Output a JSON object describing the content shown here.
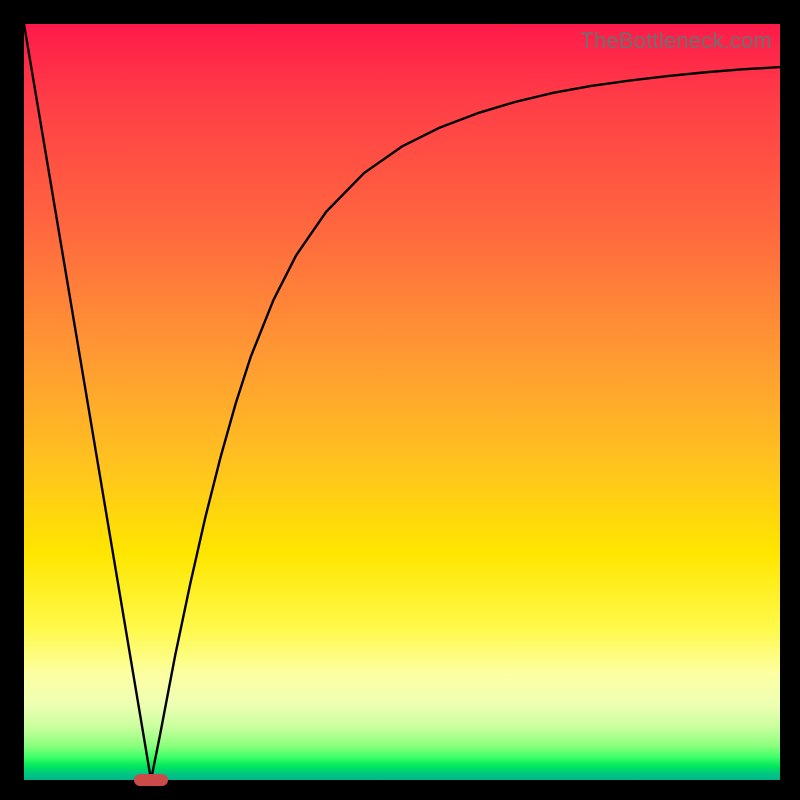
{
  "watermark": "TheBottleneck.com",
  "colors": {
    "frame": "#000000",
    "curve": "#000000",
    "min_marker": "#cc4b49",
    "gradient_top": "#ff1a4a",
    "gradient_bottom": "#00b58e"
  },
  "chart_data": {
    "type": "line",
    "title": "",
    "xlabel": "",
    "ylabel": "",
    "xlim": [
      0,
      100
    ],
    "ylim": [
      0,
      100
    ],
    "grid": false,
    "legend": false,
    "series": [
      {
        "name": "bottleneck-curve",
        "x": [
          0,
          2,
          4,
          6,
          8,
          10,
          12,
          14,
          16,
          16.8,
          18,
          20,
          22,
          24,
          26,
          28,
          30,
          33,
          36,
          40,
          45,
          50,
          55,
          60,
          65,
          70,
          75,
          80,
          85,
          90,
          95,
          100
        ],
        "y": [
          100,
          88.1,
          76.2,
          64.3,
          52.4,
          40.5,
          28.6,
          16.7,
          4.8,
          0,
          6.0,
          16.5,
          26.0,
          34.8,
          42.7,
          49.8,
          56.0,
          63.5,
          69.4,
          75.2,
          80.3,
          83.8,
          86.3,
          88.2,
          89.7,
          90.9,
          91.8,
          92.5,
          93.1,
          93.6,
          94.0,
          94.3
        ]
      }
    ],
    "min_point": {
      "x": 16.8,
      "y": 0
    },
    "background_gradient": {
      "direction": "vertical",
      "stops": [
        {
          "pos": 0,
          "color": "#ff1a4a"
        },
        {
          "pos": 28,
          "color": "#ff6a3e"
        },
        {
          "pos": 58,
          "color": "#ffc21f"
        },
        {
          "pos": 80,
          "color": "#fff94b"
        },
        {
          "pos": 93,
          "color": "#c9ff9e"
        },
        {
          "pos": 100,
          "color": "#00b58e"
        }
      ]
    }
  }
}
